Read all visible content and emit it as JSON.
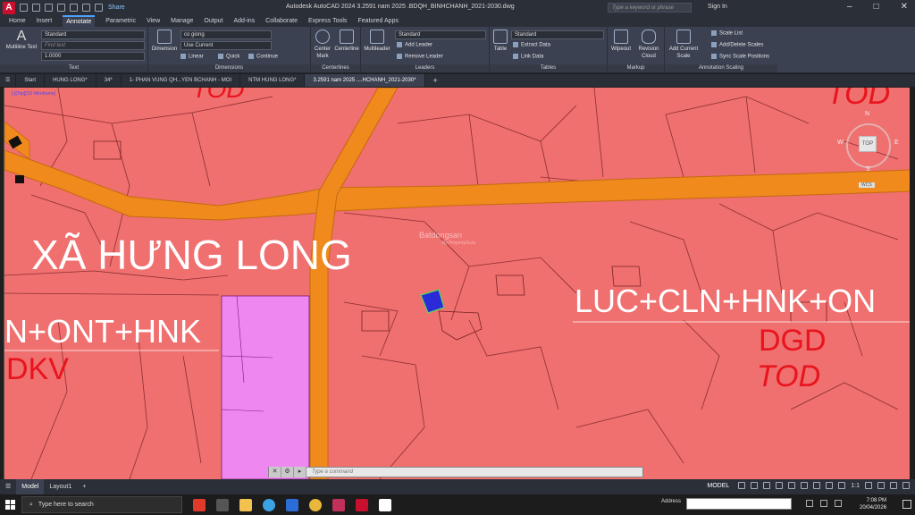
{
  "titlebar": {
    "app_icon": "A",
    "share_label": "Share",
    "title": "Autodesk AutoCAD 2024   3.2591 nam 2025 .BDQH_BINHCHANH_2021-2030.dwg",
    "search_placeholder": "Type a keyword or phrase",
    "signin": "Sign In"
  },
  "menu": [
    "Home",
    "Insert",
    "Annotate",
    "Parametric",
    "View",
    "Manage",
    "Output",
    "Add-ins",
    "Collaborate",
    "Express Tools",
    "Featured Apps"
  ],
  "menu_active": "Annotate",
  "ribbon": {
    "text_panel": {
      "label": "Text",
      "multiline_text": "Multiline Text",
      "style": "Standard",
      "find_placeholder": "Find text",
      "height": "1.0000"
    },
    "dimensions_panel": {
      "label": "Dimensions",
      "dimension": "Dimension",
      "dimstyle": "co giong",
      "layer": "Use Current",
      "linear": "Linear",
      "quick": "Quick",
      "continue": "Continue"
    },
    "centerlines_panel": {
      "label": "Centerlines",
      "center_mark": "Center Mark",
      "centerline": "Centerline"
    },
    "leaders_panel": {
      "label": "Leaders",
      "multileader": "Multileader",
      "style": "Standard",
      "add_leader": "Add Leader",
      "remove_leader": "Remove Leader"
    },
    "tables_panel": {
      "label": "Tables",
      "table": "Table",
      "style": "Standard",
      "extract_data": "Extract Data",
      "link_data": "Link Data"
    },
    "markup_panel": {
      "label": "Markup",
      "wipeout": "Wipeout",
      "revision_cloud": "Revision Cloud"
    },
    "annotation_scaling_panel": {
      "label": "Annotation Scaling",
      "add_current_scale": "Add Current Scale",
      "scale_list": "Scale List",
      "add_delete_scales": "Add/Delete Scales",
      "sync_scale_positions": "Sync Scale Positions"
    }
  },
  "file_tabs": [
    "Start",
    "HUNG LONG*",
    "34*",
    "1- PHAN VUNG QH...YEN BCHANH - MOI",
    "NTM HUNG LONG*",
    "3.2591 nam 2025 ....HCHANH_2021-2030*"
  ],
  "file_tab_active": 5,
  "drawing": {
    "viewport_label": "[-][Top][2D Wireframe]",
    "commune_name": "XÃ HƯNG LONG",
    "landuse_right": "LUC+CLN+HNK+ON",
    "landuse_left": "N+ONT+HNK",
    "code_dkv": "DKV",
    "code_dgd": "DGD",
    "code_tod": "TOD",
    "code_tod_top": "TOD",
    "watermark": "Batdongsan",
    "watermark_sub": "By PropertyGuru",
    "viewcube": {
      "top": "TOP",
      "n": "N",
      "s": "S",
      "e": "E",
      "w": "W",
      "wcs": "WCS"
    },
    "colors": {
      "base": "#f06f6f",
      "road": "#f08a1c",
      "magenta_parcel": "#ee88f0",
      "selected": "#2a2ad8"
    }
  },
  "command_line": {
    "placeholder": "Type a command"
  },
  "layout_tabs": [
    "Model",
    "Layout1"
  ],
  "layout_tab_active": "Model",
  "statusbar": {
    "model": "MODEL",
    "scale": "1:1",
    "watermark": "batdongsan"
  },
  "taskbar": {
    "search_placeholder": "Type here to search",
    "address_label": "Address",
    "time": "7:08 PM",
    "date": "20/04/2026"
  }
}
